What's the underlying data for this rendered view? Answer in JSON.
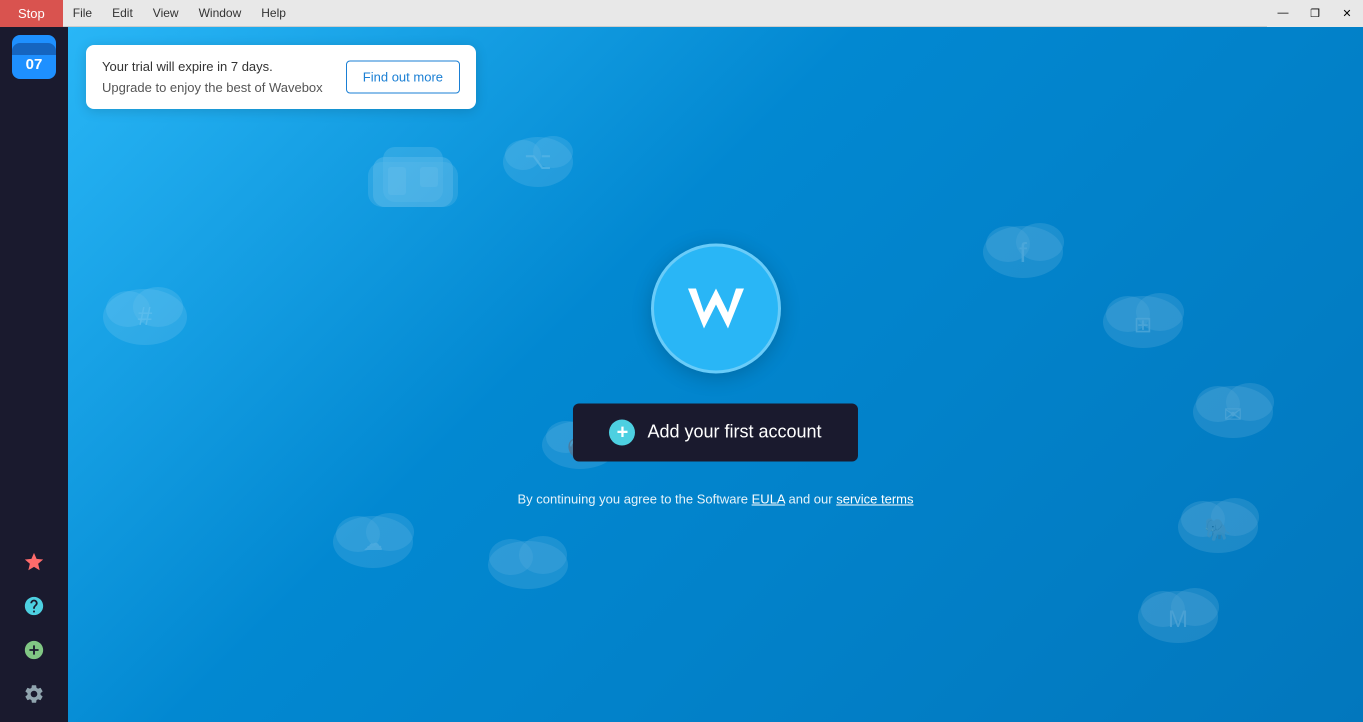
{
  "titleBar": {
    "stopLabel": "Stop",
    "menuItems": [
      "File",
      "Edit",
      "View",
      "Window",
      "Help"
    ],
    "winControls": [
      "—",
      "❐",
      "✕"
    ]
  },
  "sidebar": {
    "calendarDay": "07",
    "icons": [
      {
        "name": "star",
        "symbol": "☆",
        "class": "active"
      },
      {
        "name": "help",
        "symbol": "?",
        "class": "help"
      },
      {
        "name": "add",
        "symbol": "+",
        "class": "add"
      },
      {
        "name": "settings",
        "symbol": "⚙",
        "class": "settings"
      }
    ]
  },
  "trialBanner": {
    "text1": "Your trial will expire in 7 days.",
    "text2": "Upgrade to enjoy the best of Wavebox",
    "buttonLabel": "Find out more"
  },
  "main": {
    "addAccountLabel": "Add your first account",
    "legalPrefix": "By continuing you agree to the Software ",
    "eulaLabel": "EULA",
    "legalMiddle": " and our ",
    "serviceTermsLabel": "service terms"
  }
}
